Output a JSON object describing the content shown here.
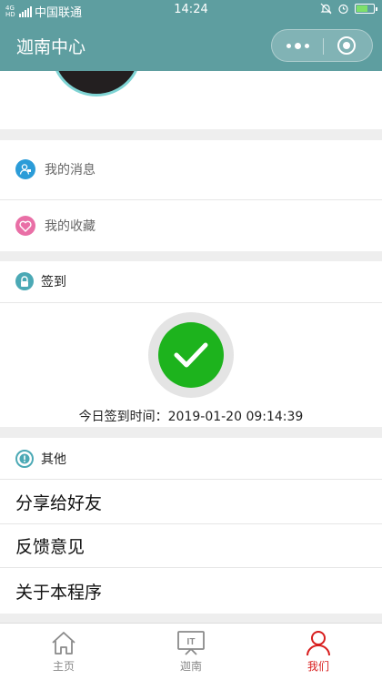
{
  "status_bar": {
    "network": "4G HD",
    "carrier": "中国联通",
    "time": "14:24",
    "battery_level": 0.7
  },
  "nav": {
    "title": "迦南中心"
  },
  "menu": {
    "messages_label": "我的消息",
    "favorites_label": "我的收藏"
  },
  "checkin": {
    "section_title": "签到",
    "sign_time_text": "今日签到时间：2019-01-20 09:14:39"
  },
  "other": {
    "section_title": "其他",
    "links": [
      "分享给好友",
      "反馈意见",
      "关于本程序"
    ]
  },
  "tabbar": {
    "items": [
      {
        "label": "主页",
        "icon": "home-icon",
        "active": false
      },
      {
        "label": "迦南",
        "icon": "it-monitor-icon",
        "active": false
      },
      {
        "label": "我们",
        "icon": "person-icon",
        "active": true
      }
    ]
  },
  "colors": {
    "nav": "#5e9ea0",
    "accent": "#d81e1e",
    "checkin": "#1db31d",
    "message_icon": "#2b9cd8",
    "favorite_icon": "#e96fa6",
    "section_icon": "#4ba9b5"
  }
}
